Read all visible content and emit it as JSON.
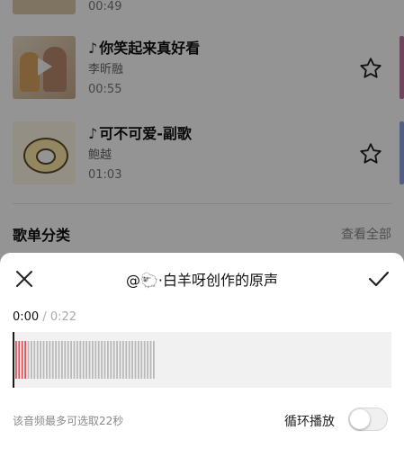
{
  "song_list": {
    "top_partial": {
      "duration": "00:49"
    },
    "songs": [
      {
        "title": "你笑起来真好看",
        "artist": "李昕融",
        "duration": "00:55"
      },
      {
        "title": "可不可爱-副歌",
        "artist": "鲍越",
        "duration": "01:03"
      }
    ],
    "tiktok_icon": "♪",
    "star_icon": "star-outline-icon"
  },
  "category": {
    "title": "歌单分类",
    "view_all": "查看全部"
  },
  "sheet": {
    "title": "@🐑·白羊呀创作的原声",
    "close_icon": "close-icon",
    "confirm_icon": "checkmark-icon",
    "current_time": "0:00",
    "separator": "/",
    "total_time": "0:22",
    "hint": "该音频最多可选取22秒",
    "loop_label": "循环播放",
    "loop_enabled": false
  },
  "waveform": {
    "selected_color": "#e0505a",
    "unselected_color": "#b8b8b8",
    "selected_count": 4,
    "total_count": 46
  },
  "colors": {
    "accent": "#e0505a",
    "overlay": "rgba(0,0,0,0.42)"
  }
}
